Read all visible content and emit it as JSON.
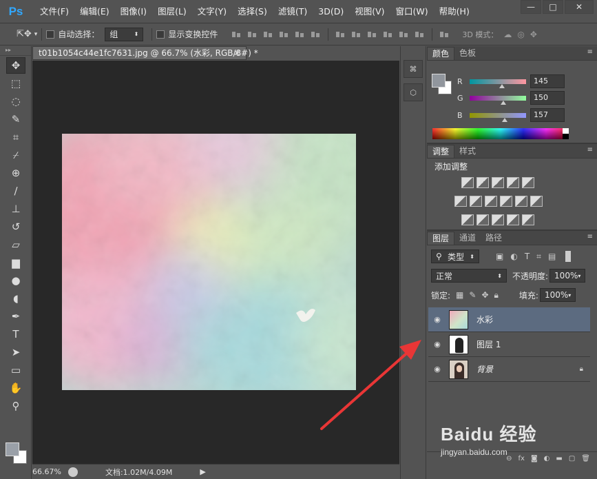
{
  "app": {
    "logo": "Ps",
    "menu": [
      "文件(F)",
      "编辑(E)",
      "图像(I)",
      "图层(L)",
      "文字(Y)",
      "选择(S)",
      "滤镜(T)",
      "3D(D)",
      "视图(V)",
      "窗口(W)",
      "帮助(H)"
    ],
    "window_buttons": [
      "—",
      "□",
      "✕"
    ]
  },
  "options": {
    "auto_select_label": "自动选择：",
    "auto_select_value": "组",
    "show_transform_label": "显示变换控件",
    "mode_label": "3D 模式："
  },
  "document": {
    "tab_title": "t01b1054c44e1fc7631.jpg @ 66.7% (水彩, RGB/8#) *",
    "zoom": "66.67%",
    "doc_info": "文档:1.02M/4.09M"
  },
  "color_panel": {
    "tabs": [
      "颜色",
      "色板"
    ],
    "r_label": "R",
    "r_value": "145",
    "g_label": "G",
    "g_value": "150",
    "b_label": "B",
    "b_value": "157",
    "foreground_color": "#9196 9d"
  },
  "adjust_panel": {
    "tabs": [
      "调整",
      "样式"
    ],
    "title": "添加调整"
  },
  "layers_panel": {
    "tabs": [
      "图层",
      "通道",
      "路径"
    ],
    "filter_label": "类型",
    "blend_mode": "正常",
    "opacity_label": "不透明度:",
    "opacity_value": "100%",
    "lock_label": "锁定:",
    "fill_label": "填充:",
    "fill_value": "100%",
    "layers": [
      {
        "name": "水彩",
        "selected": true,
        "locked": false
      },
      {
        "name": "图层 1",
        "selected": false,
        "locked": false
      },
      {
        "name": "背景",
        "selected": false,
        "locked": true
      }
    ]
  },
  "watermark": {
    "brand": "Baidu 经验",
    "url": "jingyan.baidu.com"
  }
}
